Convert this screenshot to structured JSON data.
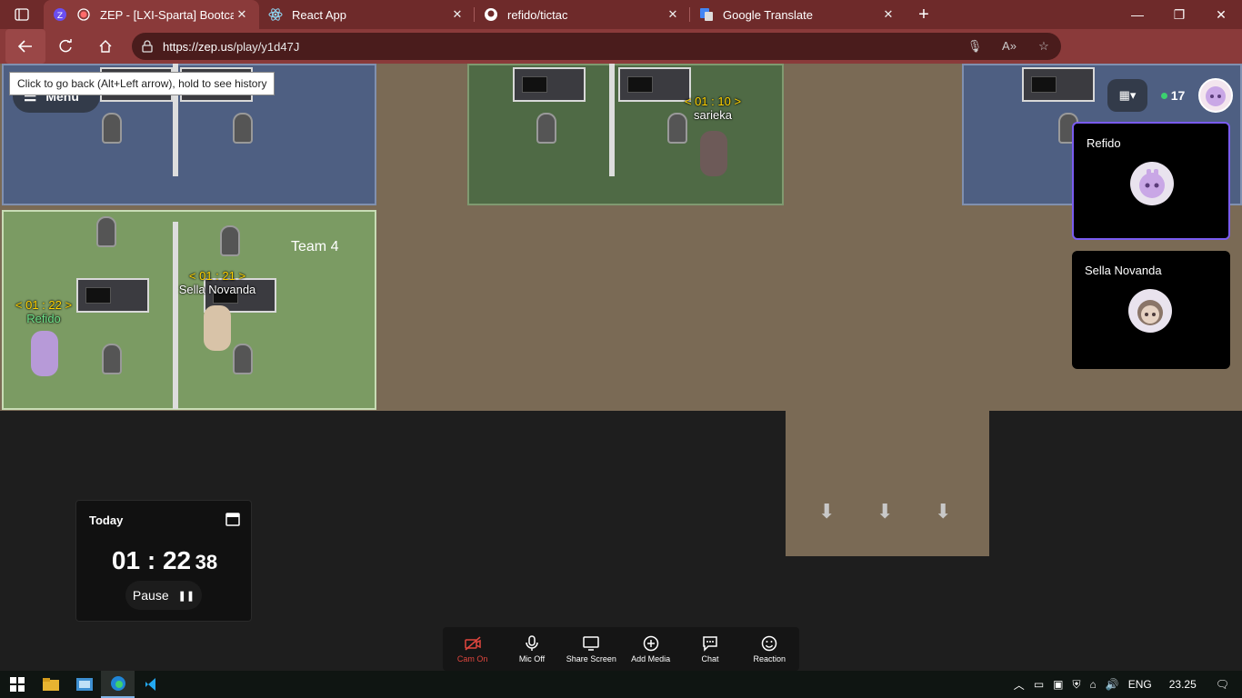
{
  "browser": {
    "tabs": [
      {
        "title": "ZEP - [LXI-Sparta] Bootcamp",
        "active": true,
        "icon": "zep-icon"
      },
      {
        "title": "React App",
        "active": false,
        "icon": "react-icon"
      },
      {
        "title": "refido/tictac",
        "active": false,
        "icon": "github-icon"
      },
      {
        "title": "Google Translate",
        "active": false,
        "icon": "google-translate-icon"
      }
    ],
    "url_host": "https://zep.us",
    "url_path": "/play/y1d47J",
    "back_tooltip": "Click to go back (Alt+Left arrow), hold to see history"
  },
  "app": {
    "menu_label": "Menu",
    "online_count": "17",
    "room_label": "Team 4",
    "players": [
      {
        "time": "< 01 : 10 >",
        "name": "sarieka"
      },
      {
        "time": "< 01 : 21 >",
        "name": "Sella Novanda"
      },
      {
        "time": "< 01 : 22 >",
        "name": "Refido"
      }
    ],
    "video_cards": [
      {
        "name": "Refido",
        "active": true
      },
      {
        "name": "Sella Novanda",
        "active": false
      }
    ],
    "timer": {
      "label": "Today",
      "hours": "01",
      "minutes": "22",
      "seconds": "38",
      "pause_label": "Pause"
    },
    "toolbar": [
      {
        "label": "Cam On",
        "icon": "camera-off-icon",
        "state": "off"
      },
      {
        "label": "Mic Off",
        "icon": "microphone-icon",
        "state": "on"
      },
      {
        "label": "Share Screen",
        "icon": "monitor-icon",
        "state": "on"
      },
      {
        "label": "Add Media",
        "icon": "plus-circle-icon",
        "state": "on"
      },
      {
        "label": "Chat",
        "icon": "chat-icon",
        "state": "on"
      },
      {
        "label": "Reaction",
        "icon": "smiley-icon",
        "state": "on"
      }
    ]
  },
  "taskbar": {
    "language": "ENG",
    "time": "23.25"
  },
  "colors": {
    "titlebar": "#6e2a2a",
    "active_tab": "#8a3a3a",
    "floor": "#7a6a55",
    "accent_purple": "#7a5cf0",
    "timer_yellow": "#ffd200",
    "cam_off_red": "#e0463e"
  }
}
